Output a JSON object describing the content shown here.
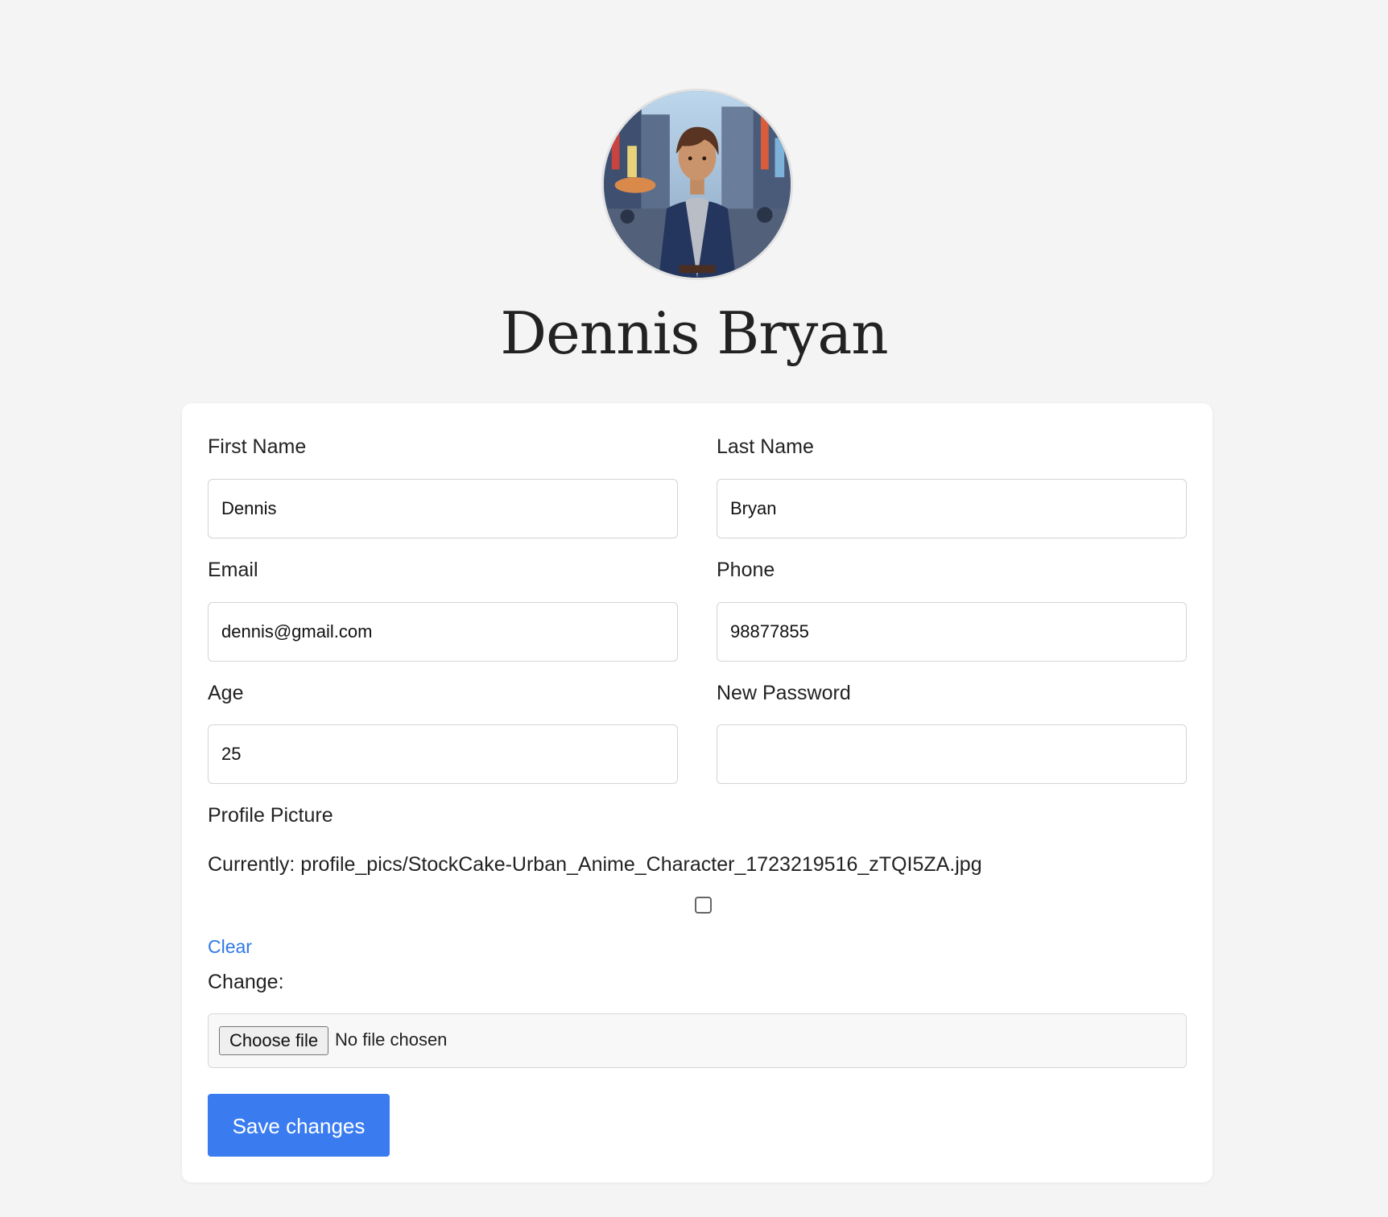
{
  "profile": {
    "name": "Dennis Bryan",
    "avatar_icon": "avatar-illustration"
  },
  "form": {
    "first_name": {
      "label": "First Name",
      "value": "Dennis"
    },
    "last_name": {
      "label": "Last Name",
      "value": "Bryan"
    },
    "email": {
      "label": "Email",
      "value": "dennis@gmail.com"
    },
    "phone": {
      "label": "Phone",
      "value": "98877855"
    },
    "age": {
      "label": "Age",
      "value": "25"
    },
    "new_password": {
      "label": "New Password",
      "value": ""
    },
    "profile_picture": {
      "label": "Profile Picture",
      "currently_text": "Currently: profile_pics/StockCake-Urban_Anime_Character_1723219516_zTQI5ZA.jpg",
      "clear_checked": false,
      "clear_label": "Clear",
      "change_label": "Change:",
      "choose_button": "Choose file",
      "file_status": "No file chosen"
    },
    "submit_label": "Save changes"
  },
  "colors": {
    "background": "#f4f4f4",
    "card": "#ffffff",
    "accent": "#3a7cf0",
    "link": "#2f78e8"
  }
}
